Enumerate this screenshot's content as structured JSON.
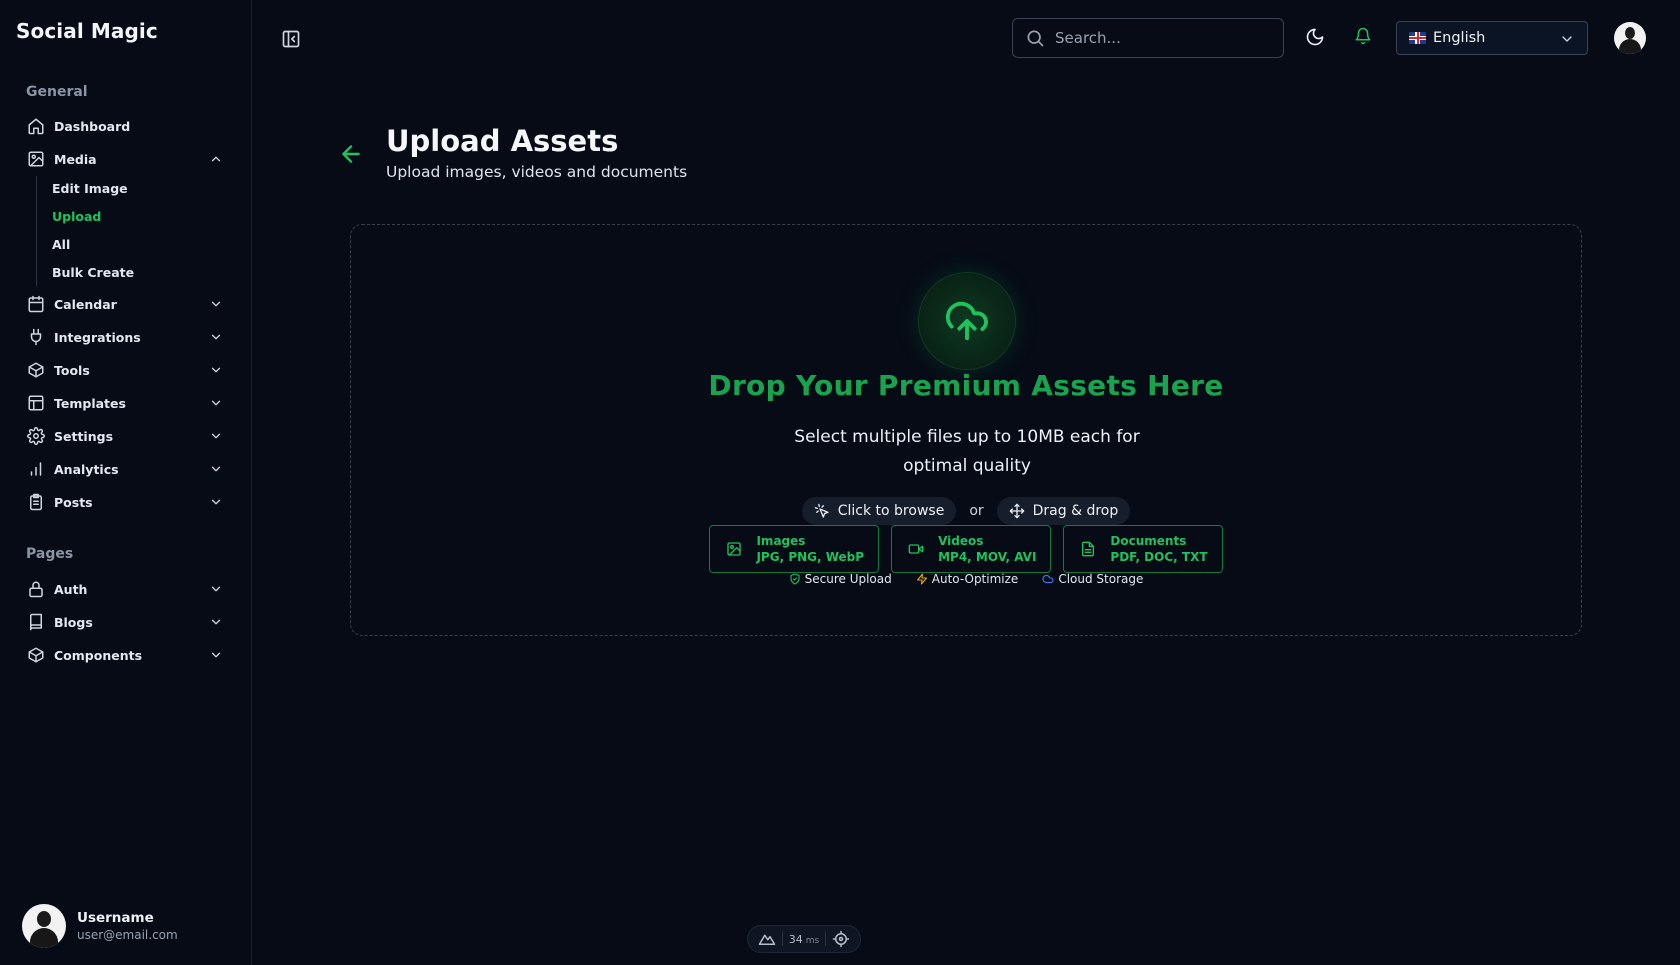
{
  "app": {
    "brand": "Social Magic"
  },
  "sidebar": {
    "general_title": "General",
    "pages_title": "Pages",
    "items": [
      {
        "label": "Dashboard",
        "icon": "home-icon"
      },
      {
        "label": "Media",
        "icon": "image-icon",
        "expanded": true
      },
      {
        "label": "Calendar",
        "icon": "calendar-icon"
      },
      {
        "label": "Integrations",
        "icon": "plug-icon"
      },
      {
        "label": "Tools",
        "icon": "box-icon"
      },
      {
        "label": "Templates",
        "icon": "layout-icon"
      },
      {
        "label": "Settings",
        "icon": "gear-icon"
      },
      {
        "label": "Analytics",
        "icon": "bar-chart-icon"
      },
      {
        "label": "Posts",
        "icon": "clipboard-icon"
      }
    ],
    "media_submenu": [
      {
        "label": "Edit Image"
      },
      {
        "label": "Upload",
        "active": true
      },
      {
        "label": "All"
      },
      {
        "label": "Bulk Create"
      }
    ],
    "pages_items": [
      {
        "label": "Auth",
        "icon": "lock-icon"
      },
      {
        "label": "Blogs",
        "icon": "book-icon"
      },
      {
        "label": "Components",
        "icon": "box-icon"
      }
    ],
    "user": {
      "name": "Username",
      "email": "user@email.com"
    }
  },
  "topbar": {
    "search_placeholder": "Search...",
    "language": "English",
    "language_flag": "uk-flag-icon"
  },
  "page": {
    "title": "Upload Assets",
    "subtitle": "Upload images, videos and documents"
  },
  "dropzone": {
    "heading": "Drop Your Premium Assets Here",
    "description": "Select multiple files up to 10MB each for optimal quality",
    "browse_label": "Click to browse",
    "or_label": "or",
    "drag_label": "Drag & drop",
    "types": [
      {
        "name": "Images",
        "formats": "JPG, PNG, WebP",
        "icon": "image-icon"
      },
      {
        "name": "Videos",
        "formats": "MP4, MOV, AVI",
        "icon": "video-icon"
      },
      {
        "name": "Documents",
        "formats": "PDF, DOC, TXT",
        "icon": "file-text-icon"
      }
    ],
    "features": [
      {
        "label": "Secure Upload",
        "icon": "shield-check-icon",
        "color": "#1ec35d"
      },
      {
        "label": "Auto-Optimize",
        "icon": "zap-icon",
        "color": "#e0a91b"
      },
      {
        "label": "Cloud Storage",
        "icon": "cloud-icon",
        "color": "#3b82f6"
      }
    ]
  },
  "perf": {
    "value": "34",
    "unit": "ms"
  },
  "colors": {
    "accent": "#1ec35d",
    "background": "#060b16",
    "heading_green": "#1aa34f"
  }
}
